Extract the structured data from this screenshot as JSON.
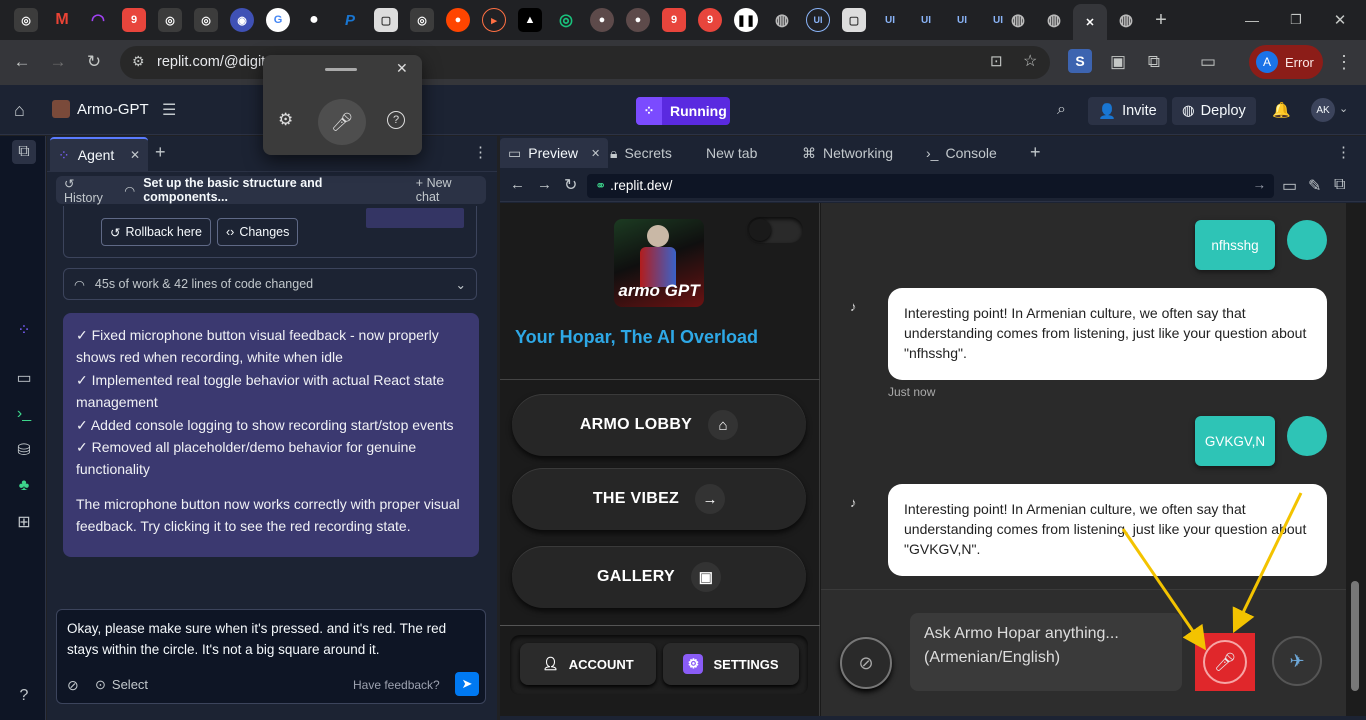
{
  "browser": {
    "url": "replit.com/@digit",
    "profile_initial": "A",
    "profile_label": "Error"
  },
  "voice_popup": {
    "settings_icon": "gear-icon",
    "mic_icon": "microphone-icon",
    "help_icon": "help-icon"
  },
  "replit": {
    "project_name": "Armo-GPT",
    "status": "Running",
    "invite": "Invite",
    "deploy": "Deploy",
    "avatar": "AK",
    "accent": "#5a2ae0"
  },
  "agent": {
    "tab_label": "Agent",
    "history": "History",
    "task_title": "Set up the basic structure and components...",
    "new_chat": "New chat",
    "rollback": "Rollback here",
    "changes": "Changes",
    "work_summary": "45s of work & 42 lines of code changed",
    "message_lines": [
      "✓ Fixed microphone button visual feedback - now properly shows red when recording, white when idle",
      "✓ Implemented real toggle behavior with actual React state management",
      "✓ Added console logging to show recording start/stop events",
      "✓ Removed all placeholder/demo behavior for genuine functionality"
    ],
    "message_footer": "The microphone button now works correctly with proper visual feedback. Try clicking it to see the red recording state.",
    "input_text": "Okay, please make sure when it's pressed. and it's red. The red stays within the circle. It's not a big square around it.",
    "select_label": "Select",
    "feedback_label": "Have feedback?"
  },
  "workspace": {
    "tabs": [
      "Preview",
      "Secrets",
      "New tab",
      "Networking",
      "Console"
    ],
    "preview_url": ".replit.dev/"
  },
  "app": {
    "logo_text": "armo GPT",
    "tagline": "Your Hopar, The AI Overload",
    "nav": [
      "ARMO LOBBY",
      "THE VIBEZ",
      "GALLERY"
    ],
    "account": "ACCOUNT",
    "settings": "SETTINGS",
    "messages": [
      {
        "role": "user",
        "text": "nfhsshg"
      },
      {
        "role": "assistant",
        "text": "Interesting point! In Armenian culture, we often say that understanding comes from listening, just like your question about \"nfhsshg\".",
        "time": "Just now"
      },
      {
        "role": "user",
        "text": "GVKGV,N"
      },
      {
        "role": "assistant",
        "text": "Interesting point! In Armenian culture, we often say that understanding comes from listening, just like your question about \"GVKGV,N\"."
      }
    ],
    "composer_placeholder": "Ask Armo Hopar anything... (Armenian/English)",
    "teal": "#2ec4b6",
    "record_red": "#e0272b"
  }
}
